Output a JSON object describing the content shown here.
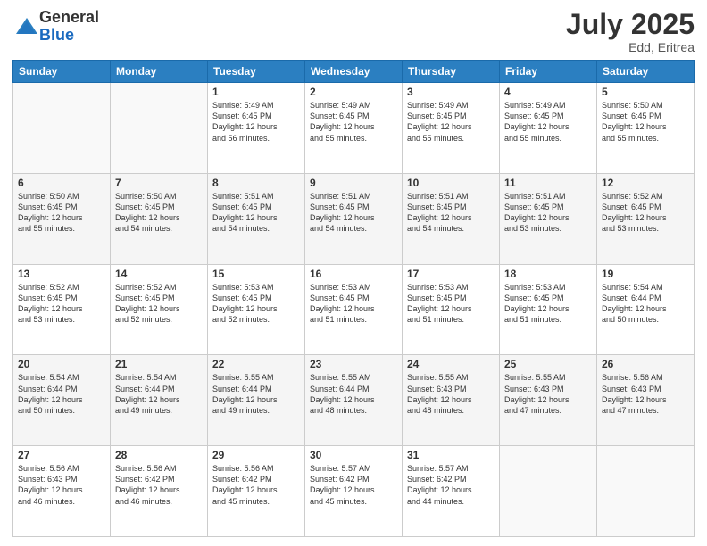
{
  "header": {
    "logo_general": "General",
    "logo_blue": "Blue",
    "month": "July 2025",
    "location": "Edd, Eritrea"
  },
  "weekdays": [
    "Sunday",
    "Monday",
    "Tuesday",
    "Wednesday",
    "Thursday",
    "Friday",
    "Saturday"
  ],
  "weeks": [
    {
      "days": [
        {
          "num": "",
          "info": ""
        },
        {
          "num": "",
          "info": ""
        },
        {
          "num": "1",
          "info": "Sunrise: 5:49 AM\nSunset: 6:45 PM\nDaylight: 12 hours\nand 56 minutes."
        },
        {
          "num": "2",
          "info": "Sunrise: 5:49 AM\nSunset: 6:45 PM\nDaylight: 12 hours\nand 55 minutes."
        },
        {
          "num": "3",
          "info": "Sunrise: 5:49 AM\nSunset: 6:45 PM\nDaylight: 12 hours\nand 55 minutes."
        },
        {
          "num": "4",
          "info": "Sunrise: 5:49 AM\nSunset: 6:45 PM\nDaylight: 12 hours\nand 55 minutes."
        },
        {
          "num": "5",
          "info": "Sunrise: 5:50 AM\nSunset: 6:45 PM\nDaylight: 12 hours\nand 55 minutes."
        }
      ]
    },
    {
      "days": [
        {
          "num": "6",
          "info": "Sunrise: 5:50 AM\nSunset: 6:45 PM\nDaylight: 12 hours\nand 55 minutes."
        },
        {
          "num": "7",
          "info": "Sunrise: 5:50 AM\nSunset: 6:45 PM\nDaylight: 12 hours\nand 54 minutes."
        },
        {
          "num": "8",
          "info": "Sunrise: 5:51 AM\nSunset: 6:45 PM\nDaylight: 12 hours\nand 54 minutes."
        },
        {
          "num": "9",
          "info": "Sunrise: 5:51 AM\nSunset: 6:45 PM\nDaylight: 12 hours\nand 54 minutes."
        },
        {
          "num": "10",
          "info": "Sunrise: 5:51 AM\nSunset: 6:45 PM\nDaylight: 12 hours\nand 54 minutes."
        },
        {
          "num": "11",
          "info": "Sunrise: 5:51 AM\nSunset: 6:45 PM\nDaylight: 12 hours\nand 53 minutes."
        },
        {
          "num": "12",
          "info": "Sunrise: 5:52 AM\nSunset: 6:45 PM\nDaylight: 12 hours\nand 53 minutes."
        }
      ]
    },
    {
      "days": [
        {
          "num": "13",
          "info": "Sunrise: 5:52 AM\nSunset: 6:45 PM\nDaylight: 12 hours\nand 53 minutes."
        },
        {
          "num": "14",
          "info": "Sunrise: 5:52 AM\nSunset: 6:45 PM\nDaylight: 12 hours\nand 52 minutes."
        },
        {
          "num": "15",
          "info": "Sunrise: 5:53 AM\nSunset: 6:45 PM\nDaylight: 12 hours\nand 52 minutes."
        },
        {
          "num": "16",
          "info": "Sunrise: 5:53 AM\nSunset: 6:45 PM\nDaylight: 12 hours\nand 51 minutes."
        },
        {
          "num": "17",
          "info": "Sunrise: 5:53 AM\nSunset: 6:45 PM\nDaylight: 12 hours\nand 51 minutes."
        },
        {
          "num": "18",
          "info": "Sunrise: 5:53 AM\nSunset: 6:45 PM\nDaylight: 12 hours\nand 51 minutes."
        },
        {
          "num": "19",
          "info": "Sunrise: 5:54 AM\nSunset: 6:44 PM\nDaylight: 12 hours\nand 50 minutes."
        }
      ]
    },
    {
      "days": [
        {
          "num": "20",
          "info": "Sunrise: 5:54 AM\nSunset: 6:44 PM\nDaylight: 12 hours\nand 50 minutes."
        },
        {
          "num": "21",
          "info": "Sunrise: 5:54 AM\nSunset: 6:44 PM\nDaylight: 12 hours\nand 49 minutes."
        },
        {
          "num": "22",
          "info": "Sunrise: 5:55 AM\nSunset: 6:44 PM\nDaylight: 12 hours\nand 49 minutes."
        },
        {
          "num": "23",
          "info": "Sunrise: 5:55 AM\nSunset: 6:44 PM\nDaylight: 12 hours\nand 48 minutes."
        },
        {
          "num": "24",
          "info": "Sunrise: 5:55 AM\nSunset: 6:43 PM\nDaylight: 12 hours\nand 48 minutes."
        },
        {
          "num": "25",
          "info": "Sunrise: 5:55 AM\nSunset: 6:43 PM\nDaylight: 12 hours\nand 47 minutes."
        },
        {
          "num": "26",
          "info": "Sunrise: 5:56 AM\nSunset: 6:43 PM\nDaylight: 12 hours\nand 47 minutes."
        }
      ]
    },
    {
      "days": [
        {
          "num": "27",
          "info": "Sunrise: 5:56 AM\nSunset: 6:43 PM\nDaylight: 12 hours\nand 46 minutes."
        },
        {
          "num": "28",
          "info": "Sunrise: 5:56 AM\nSunset: 6:42 PM\nDaylight: 12 hours\nand 46 minutes."
        },
        {
          "num": "29",
          "info": "Sunrise: 5:56 AM\nSunset: 6:42 PM\nDaylight: 12 hours\nand 45 minutes."
        },
        {
          "num": "30",
          "info": "Sunrise: 5:57 AM\nSunset: 6:42 PM\nDaylight: 12 hours\nand 45 minutes."
        },
        {
          "num": "31",
          "info": "Sunrise: 5:57 AM\nSunset: 6:42 PM\nDaylight: 12 hours\nand 44 minutes."
        },
        {
          "num": "",
          "info": ""
        },
        {
          "num": "",
          "info": ""
        }
      ]
    }
  ]
}
